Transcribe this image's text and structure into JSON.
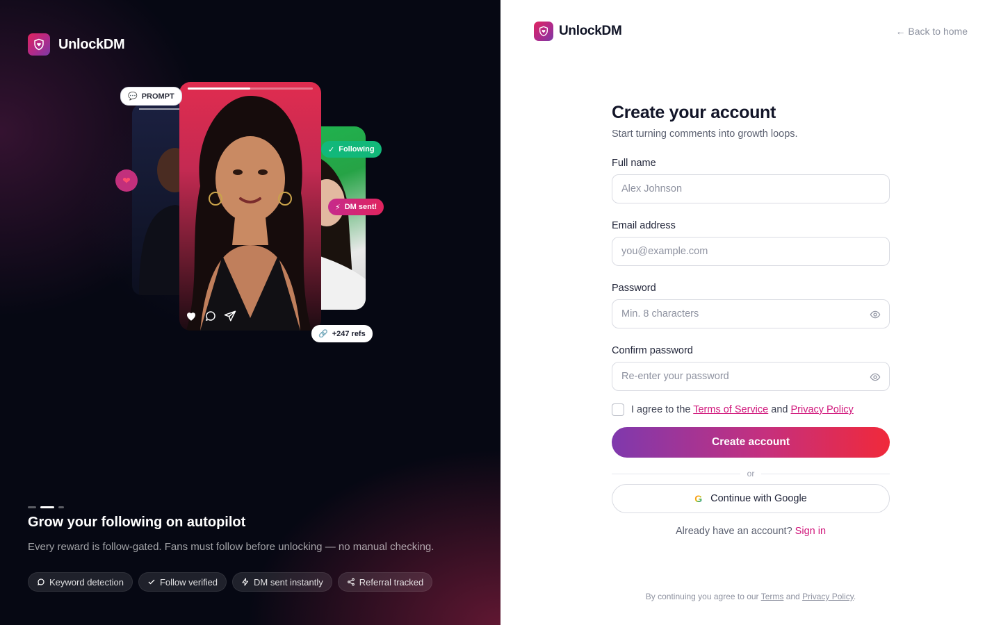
{
  "brand": {
    "name": "UnlockDM"
  },
  "left": {
    "chips": {
      "prompt": "PROMPT",
      "following": "Following",
      "dm_sent": "DM sent!",
      "refs": "+247 refs"
    },
    "headline": "Grow your following on autopilot",
    "subline": "Every reward is follow-gated. Fans must follow before unlocking — no manual checking.",
    "features": [
      {
        "icon": "chat-bubble-icon",
        "label": "Keyword detection"
      },
      {
        "icon": "check-icon",
        "label": "Follow verified"
      },
      {
        "icon": "lightning-icon",
        "label": "DM sent instantly"
      },
      {
        "icon": "share-icon",
        "label": "Referral tracked"
      }
    ]
  },
  "header": {
    "back_link": "← Back to home"
  },
  "form": {
    "title": "Create your account",
    "subtitle": "Start turning comments into growth loops.",
    "full_name": {
      "label": "Full name",
      "placeholder": "Alex Johnson",
      "value": ""
    },
    "email": {
      "label": "Email address",
      "placeholder": "you@example.com",
      "value": ""
    },
    "password": {
      "label": "Password",
      "placeholder": "Min. 8 characters",
      "value": ""
    },
    "confirm_password": {
      "label": "Confirm password",
      "placeholder": "Re-enter your password",
      "value": ""
    },
    "agree": {
      "prefix": "I agree to the",
      "terms": "Terms of Service",
      "and": "and",
      "privacy": "Privacy Policy"
    },
    "submit": "Create account",
    "divider": "or",
    "google": "Continue with Google",
    "signin_prompt": "Already have an account?",
    "signin_link": "Sign in"
  },
  "legal": {
    "prefix": "By continuing you agree to our",
    "terms": "Terms",
    "and": "and",
    "privacy": "Privacy Policy",
    "suffix": "."
  },
  "colors": {
    "accent": "#d0157a",
    "gradient_start": "#7f39ad",
    "gradient_end": "#f0293a",
    "dark_bg": "#060813"
  }
}
